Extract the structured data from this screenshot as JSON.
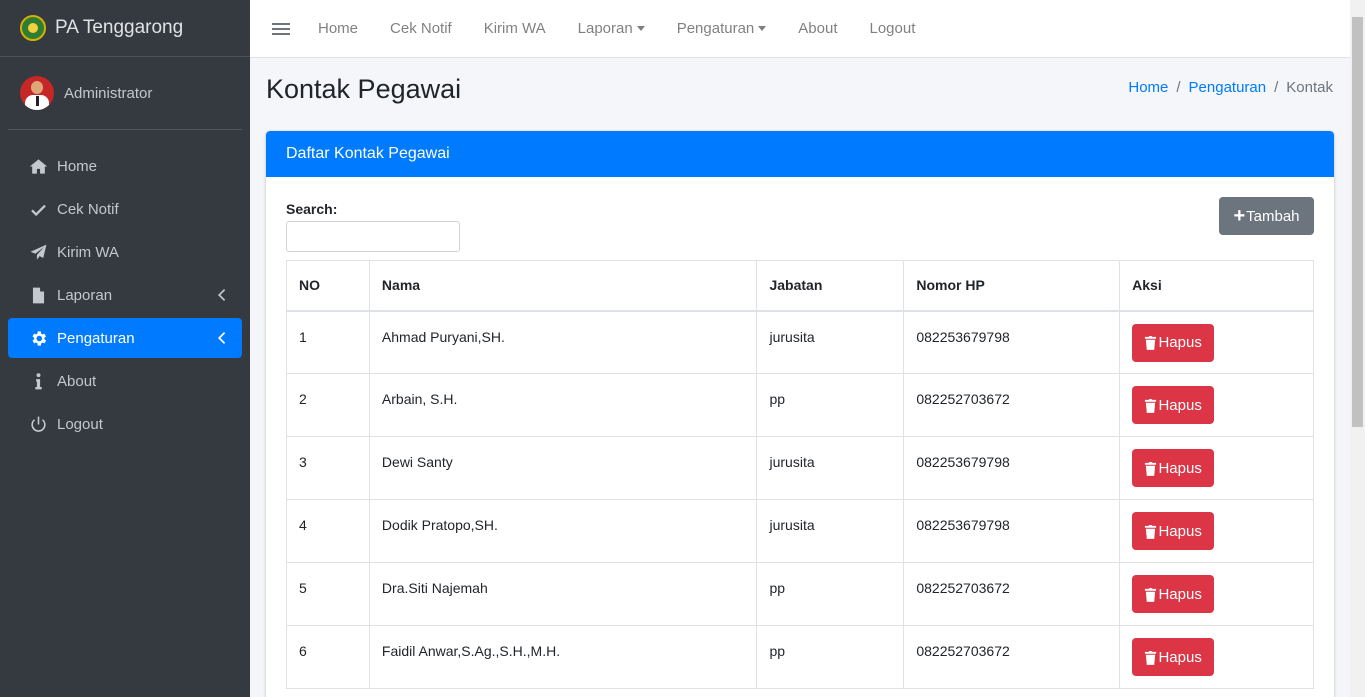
{
  "brand": {
    "title": "PA Tenggarong"
  },
  "user": {
    "name": "Administrator"
  },
  "sidebar": {
    "items": [
      {
        "label": "Home"
      },
      {
        "label": "Cek Notif"
      },
      {
        "label": "Kirim WA"
      },
      {
        "label": "Laporan"
      },
      {
        "label": "Pengaturan"
      },
      {
        "label": "About"
      },
      {
        "label": "Logout"
      }
    ]
  },
  "topnav": {
    "items": [
      {
        "label": "Home"
      },
      {
        "label": "Cek Notif"
      },
      {
        "label": "Kirim WA"
      },
      {
        "label": "Laporan"
      },
      {
        "label": "Pengaturan"
      },
      {
        "label": "About"
      },
      {
        "label": "Logout"
      }
    ]
  },
  "page": {
    "title": "Kontak Pegawai",
    "breadcrumb": [
      "Home",
      "Pengaturan",
      "Kontak"
    ]
  },
  "card": {
    "header": "Daftar Kontak Pegawai",
    "search_label": "Search:",
    "add_button": "Tambah",
    "delete_button": "Hapus"
  },
  "table": {
    "headers": [
      "NO",
      "Nama",
      "Jabatan",
      "Nomor HP",
      "Aksi"
    ],
    "rows": [
      {
        "no": "1",
        "nama": "Ahmad Puryani,SH.",
        "jabatan": "jurusita",
        "hp": "082253679798"
      },
      {
        "no": "2",
        "nama": "Arbain, S.H.",
        "jabatan": "pp",
        "hp": "082252703672"
      },
      {
        "no": "3",
        "nama": "Dewi Santy",
        "jabatan": "jurusita",
        "hp": "082253679798"
      },
      {
        "no": "4",
        "nama": "Dodik Pratopo,SH.",
        "jabatan": "jurusita",
        "hp": "082253679798"
      },
      {
        "no": "5",
        "nama": "Dra.Siti Najemah",
        "jabatan": "pp",
        "hp": "082252703672"
      },
      {
        "no": "6",
        "nama": "Faidil Anwar,S.Ag.,S.H.,M.H.",
        "jabatan": "pp",
        "hp": "082252703672"
      }
    ]
  },
  "colors": {
    "sidebar_bg": "#343a40",
    "primary": "#007bff",
    "danger": "#dc3545",
    "secondary": "#6c757d"
  },
  "icons": [
    "menu-icon",
    "home-icon",
    "check-icon",
    "paper-plane-icon",
    "file-icon",
    "gear-icon",
    "info-icon",
    "power-icon",
    "chevron-left-icon",
    "plus-icon",
    "trash-icon"
  ]
}
